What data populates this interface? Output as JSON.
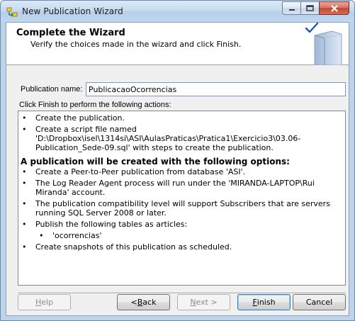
{
  "window": {
    "title": "New Publication Wizard"
  },
  "header": {
    "title": "Complete the Wizard",
    "subtitle": "Verify the choices made in the wizard and click Finish."
  },
  "form": {
    "publication_name_label": "Publication name:",
    "publication_name_value": "PublicacaoOcorrencias",
    "click_finish_label": "Click Finish to perform the following actions:"
  },
  "actions": {
    "items": [
      "Create the publication.",
      "Create a script file named 'D:\\Dropbox\\isel\\1314si\\ASI\\AulasPraticas\\Pratica1\\Exercicio3\\03.06-Publication_Sede-09.sql' with steps to create the publication."
    ],
    "options_heading": "A publication will be created with the following options:",
    "options": [
      "Create a Peer-to-Peer publication from database 'ASI'.",
      "The Log Reader Agent process will run under the 'MIRANDA-LAPTOP\\Rui Miranda' account.",
      "The publication compatibility level will support Subscribers that are servers running SQL Server 2008 or later.",
      "Publish the following tables as articles:"
    ],
    "articles": [
      "'ocorrencias'"
    ],
    "final_option": "Create snapshots of this publication as scheduled.",
    "bullet": "•"
  },
  "buttons": {
    "help": {
      "mnemonic": "H",
      "rest": "elp"
    },
    "back": {
      "prefix": "< ",
      "mnemonic": "B",
      "rest": "ack"
    },
    "next": {
      "mnemonic": "N",
      "rest": "ext >"
    },
    "finish": {
      "mnemonic": "F",
      "rest": "inish"
    },
    "cancel": {
      "label": "Cancel"
    }
  },
  "colors": {
    "accent_check": "#1e5aa8",
    "close_button": "#c8432b"
  }
}
